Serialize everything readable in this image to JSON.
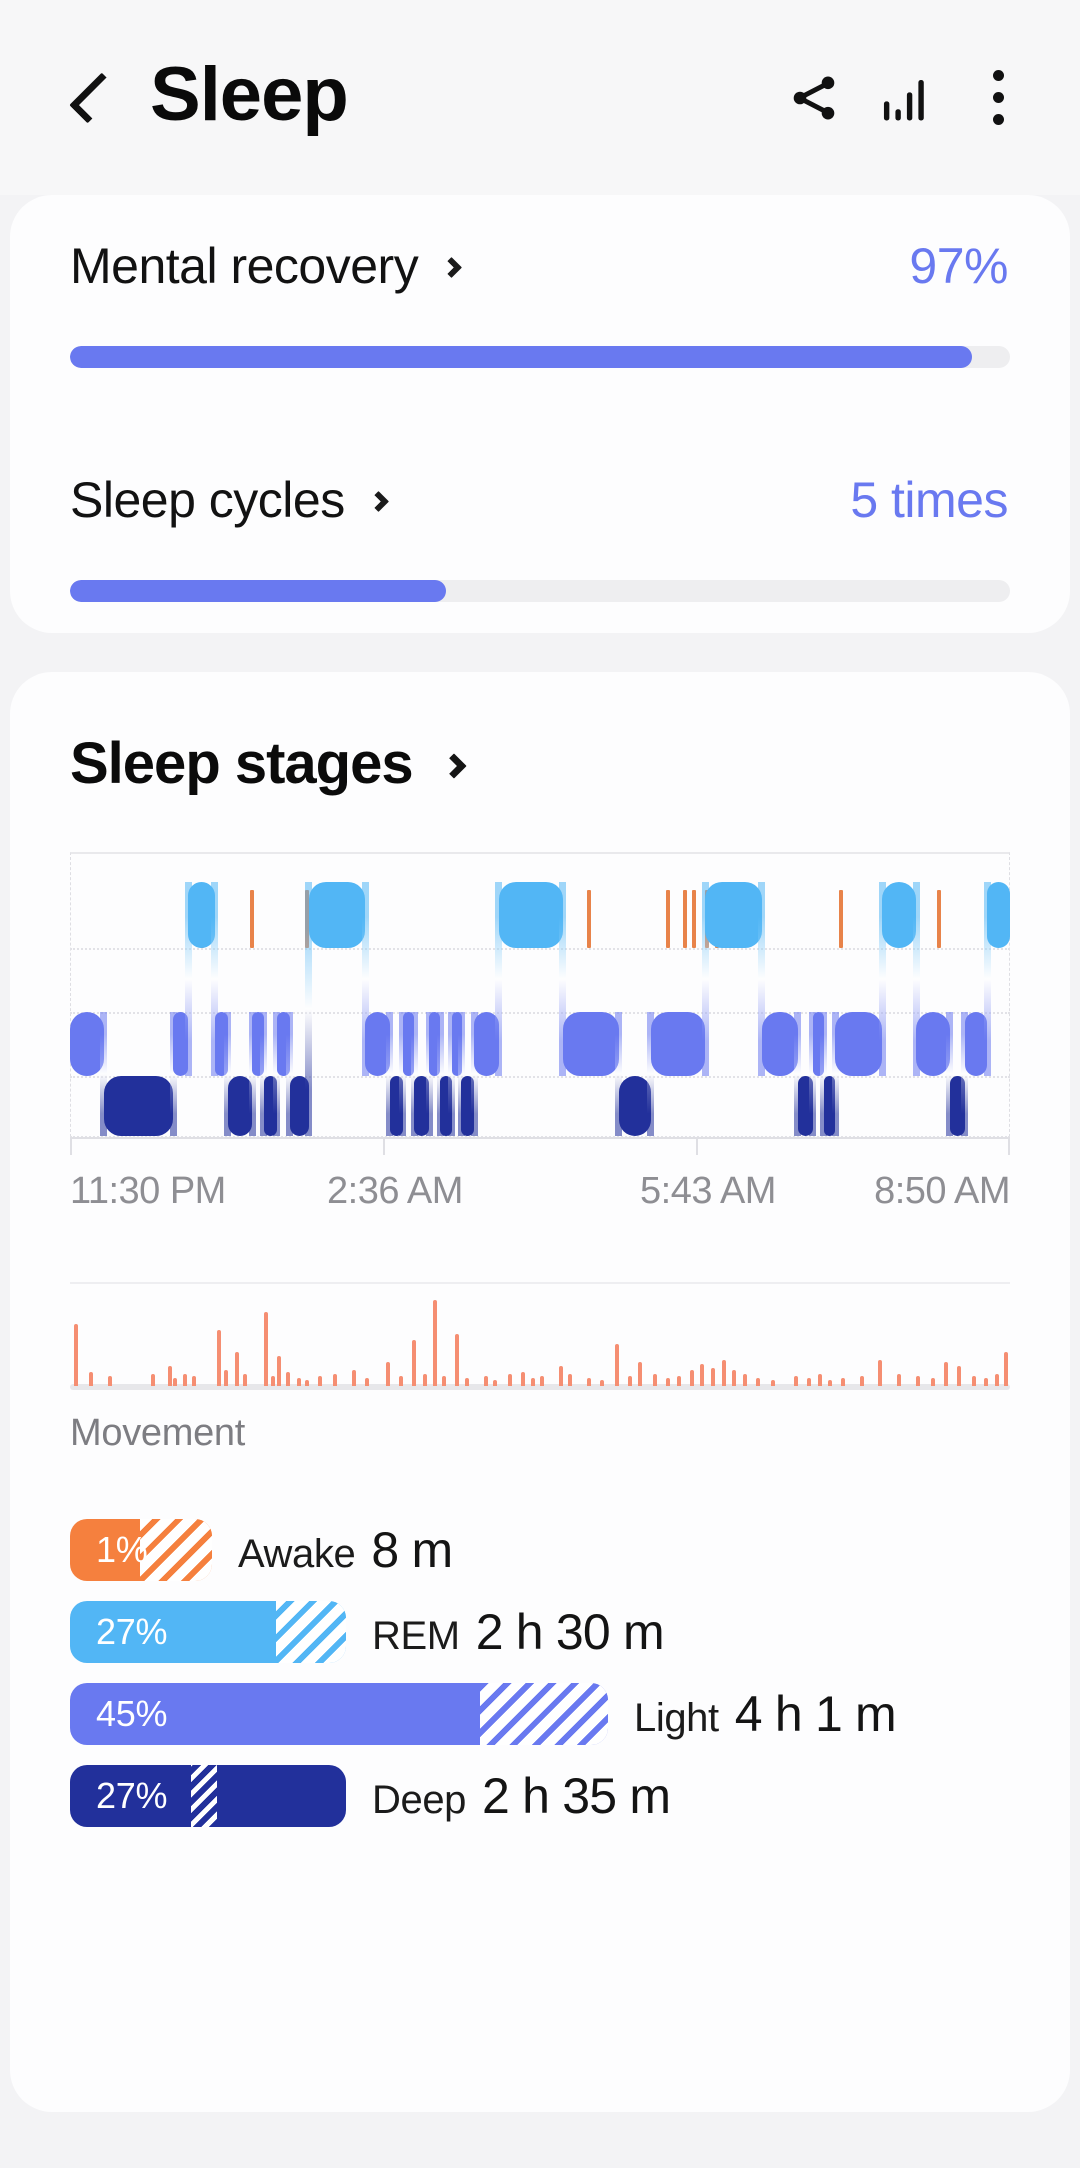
{
  "appbar": {
    "title": "Sleep",
    "back_icon": "chevron-left-icon",
    "share_icon": "share-icon",
    "chart_icon": "bar-chart-icon",
    "more_icon": "more-vertical-icon"
  },
  "summary": {
    "rows": [
      {
        "label": "Mental recovery",
        "value": "97%",
        "percent": 96
      },
      {
        "label": "Sleep cycles",
        "value": "5 times",
        "percent": 40
      }
    ]
  },
  "stages": {
    "title": "Sleep stages",
    "movement_label": "Movement",
    "legend": [
      {
        "name": "Awake",
        "percent_label": "1%",
        "duration": "8 m",
        "color": "#f5803e",
        "solid_w": 70,
        "hatch_w": 72
      },
      {
        "name": "REM",
        "percent_label": "27%",
        "duration": "2 h 30 m",
        "color": "#52b6f5",
        "solid_w": 206,
        "hatch_w": 70
      },
      {
        "name": "Light",
        "percent_label": "45%",
        "duration": "4 h 1 m",
        "color": "#6979f0",
        "solid_w": 410,
        "hatch_w": 128
      },
      {
        "name": "Deep",
        "percent_label": "27%",
        "duration": "2 h 35 m",
        "color": "#22309b",
        "solid_w": 276,
        "hatch_w": 0
      }
    ]
  },
  "chart_data": {
    "type": "area",
    "title": "Sleep stages",
    "xlabel": "",
    "ylabel": "",
    "x_tick_labels": [
      "11:30 PM",
      "2:36 AM",
      "5:43 AM",
      "8:50 AM"
    ],
    "x_tick_positions": [
      0,
      33.3,
      66.6,
      100
    ],
    "start_time": "11:30 PM",
    "end_time": "8:50 AM",
    "grid": true,
    "legend_position": "bottom",
    "stage_levels": [
      "Awake",
      "REM",
      "Light",
      "Deep"
    ],
    "stage_colors": {
      "Awake": "#e8834a",
      "REM": "#52b6f5",
      "Light": "#6979f0",
      "Deep": "#22309b"
    },
    "awake_events_pct": [
      13.8,
      19.2,
      25.0,
      55.0,
      63.4,
      65.2,
      66.2,
      67.6,
      68.6,
      81.8,
      92.2
    ],
    "segments": [
      {
        "stage": "Light",
        "start_pct": 0.0,
        "end_pct": 3.6
      },
      {
        "stage": "Deep",
        "start_pct": 3.6,
        "end_pct": 11.0
      },
      {
        "stage": "Light",
        "start_pct": 11.0,
        "end_pct": 12.6
      },
      {
        "stage": "REM",
        "start_pct": 12.6,
        "end_pct": 15.4
      },
      {
        "stage": "Light",
        "start_pct": 15.4,
        "end_pct": 16.8
      },
      {
        "stage": "Deep",
        "start_pct": 16.8,
        "end_pct": 19.4
      },
      {
        "stage": "Light",
        "start_pct": 19.4,
        "end_pct": 20.6
      },
      {
        "stage": "Deep",
        "start_pct": 20.6,
        "end_pct": 22.0
      },
      {
        "stage": "Light",
        "start_pct": 22.0,
        "end_pct": 23.4
      },
      {
        "stage": "Deep",
        "start_pct": 23.4,
        "end_pct": 25.4
      },
      {
        "stage": "REM",
        "start_pct": 25.4,
        "end_pct": 31.4
      },
      {
        "stage": "Light",
        "start_pct": 31.4,
        "end_pct": 34.0
      },
      {
        "stage": "Deep",
        "start_pct": 34.0,
        "end_pct": 35.4
      },
      {
        "stage": "Light",
        "start_pct": 35.4,
        "end_pct": 36.6
      },
      {
        "stage": "Deep",
        "start_pct": 36.6,
        "end_pct": 38.2
      },
      {
        "stage": "Light",
        "start_pct": 38.2,
        "end_pct": 39.4
      },
      {
        "stage": "Deep",
        "start_pct": 39.4,
        "end_pct": 40.6
      },
      {
        "stage": "Light",
        "start_pct": 40.6,
        "end_pct": 41.6
      },
      {
        "stage": "Deep",
        "start_pct": 41.6,
        "end_pct": 43.0
      },
      {
        "stage": "Light",
        "start_pct": 43.0,
        "end_pct": 45.6
      },
      {
        "stage": "REM",
        "start_pct": 45.6,
        "end_pct": 52.4
      },
      {
        "stage": "Light",
        "start_pct": 52.4,
        "end_pct": 58.4
      },
      {
        "stage": "Deep",
        "start_pct": 58.4,
        "end_pct": 61.8
      },
      {
        "stage": "Light",
        "start_pct": 61.8,
        "end_pct": 67.6
      },
      {
        "stage": "REM",
        "start_pct": 67.6,
        "end_pct": 73.6
      },
      {
        "stage": "Light",
        "start_pct": 73.6,
        "end_pct": 77.4
      },
      {
        "stage": "Deep",
        "start_pct": 77.4,
        "end_pct": 79.0
      },
      {
        "stage": "Light",
        "start_pct": 79.0,
        "end_pct": 80.2
      },
      {
        "stage": "Deep",
        "start_pct": 80.2,
        "end_pct": 81.4
      },
      {
        "stage": "Light",
        "start_pct": 81.4,
        "end_pct": 86.4
      },
      {
        "stage": "REM",
        "start_pct": 86.4,
        "end_pct": 90.0
      },
      {
        "stage": "Light",
        "start_pct": 90.0,
        "end_pct": 93.6
      },
      {
        "stage": "Deep",
        "start_pct": 93.6,
        "end_pct": 95.2
      },
      {
        "stage": "Light",
        "start_pct": 95.2,
        "end_pct": 97.6
      },
      {
        "stage": "REM",
        "start_pct": 97.6,
        "end_pct": 100.0
      }
    ],
    "movement": {
      "color": "#f58e72",
      "label": "Movement",
      "spikes_pct": [
        0.4,
        2.0,
        4.0,
        8.6,
        10.4,
        11.0,
        12.0,
        13.0,
        15.6,
        16.4,
        17.6,
        18.4,
        20.6,
        21.4,
        22.0,
        23.0,
        24.2,
        25.0,
        26.4,
        28.0,
        30.0,
        31.4,
        33.6,
        35.0,
        36.4,
        37.6,
        38.6,
        39.6,
        41.0,
        42.0,
        44.0,
        45.0,
        46.6,
        48.0,
        49.0,
        50.0,
        52.0,
        53.0,
        55.0,
        56.4,
        58.0,
        59.4,
        60.4,
        62.0,
        63.4,
        64.6,
        66.0,
        67.0,
        68.2,
        69.4,
        70.4,
        71.6,
        73.0,
        74.6,
        77.0,
        78.4,
        79.6,
        80.6,
        82.0,
        84.0,
        86.0,
        88.0,
        90.0,
        91.6,
        93.0,
        94.4,
        96.0,
        97.2,
        98.4,
        99.4
      ],
      "spikes_height": [
        62,
        14,
        10,
        12,
        20,
        8,
        12,
        10,
        56,
        16,
        34,
        12,
        74,
        10,
        30,
        14,
        8,
        6,
        10,
        12,
        16,
        8,
        24,
        10,
        46,
        12,
        86,
        10,
        52,
        8,
        10,
        6,
        12,
        14,
        8,
        10,
        20,
        12,
        8,
        6,
        42,
        10,
        24,
        12,
        8,
        10,
        16,
        22,
        18,
        26,
        16,
        12,
        8,
        6,
        10,
        8,
        12,
        6,
        8,
        10,
        26,
        12,
        10,
        8,
        24,
        20,
        10,
        8,
        12,
        34
      ]
    }
  }
}
